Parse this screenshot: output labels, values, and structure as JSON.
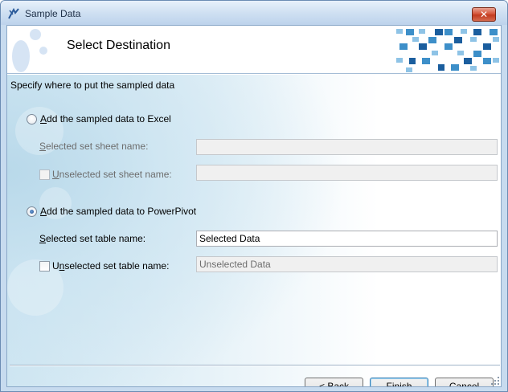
{
  "window": {
    "title": "Sample Data",
    "close_glyph": "✕"
  },
  "banner": {
    "title": "Select Destination"
  },
  "instruction": "Specify where to put the sampled data",
  "excel": {
    "radio_label_pre": "",
    "radio_label_accel": "A",
    "radio_label_post": "dd the sampled data to Excel",
    "selected": false,
    "selected_sheet_label_accel": "S",
    "selected_sheet_label_post": "elected set sheet name:",
    "selected_sheet_value": "",
    "unselected_sheet_label_accel": "U",
    "unselected_sheet_label_post": "nselected set sheet name:",
    "unselected_sheet_checked": false,
    "unselected_sheet_value": ""
  },
  "powerpivot": {
    "radio_label_pre": "",
    "radio_label_accel": "A",
    "radio_label_post": "dd the sampled data to PowerPivot",
    "selected": true,
    "selected_table_label_accel": "S",
    "selected_table_label_post": "elected set table name:",
    "selected_table_value": "Selected Data",
    "unselected_table_label_pre": "U",
    "unselected_table_label_accel": "n",
    "unselected_table_label_post": "selected set table name:",
    "unselected_table_checked": false,
    "unselected_table_value": "Unselected Data"
  },
  "buttons": {
    "back_pre": "< ",
    "back_accel": "B",
    "back_post": "ack",
    "finish_accel": "F",
    "finish_post": "inish",
    "cancel_accel": "C",
    "cancel_post": "ancel"
  },
  "colors": {
    "accent": "#3c7fb1",
    "mosaic_dark": "#1b5e9e",
    "mosaic_mid": "#3d8fc9",
    "mosaic_light": "#8ec3e6"
  }
}
